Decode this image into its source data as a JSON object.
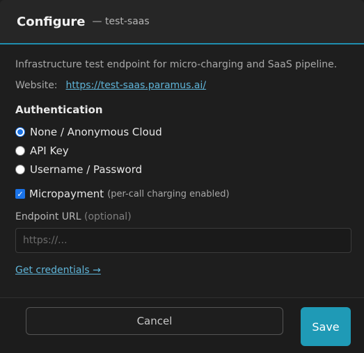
{
  "header": {
    "title": "Configure",
    "subtitle": "— test-saas"
  },
  "description": "Infrastructure test endpoint for micro-charging and SaaS pipeline.",
  "website": {
    "label": "Website:",
    "url": "https://test-saas.paramus.ai/"
  },
  "auth": {
    "title": "Authentication",
    "options": [
      {
        "label": "None / Anonymous Cloud",
        "checked": true
      },
      {
        "label": "API Key",
        "checked": false
      },
      {
        "label": "Username / Password",
        "checked": false
      }
    ]
  },
  "micropayment": {
    "label": "Micropayment",
    "hint": "(per-call charging enabled)",
    "checked": true
  },
  "endpoint": {
    "label": "Endpoint URL",
    "optional": "(optional)",
    "placeholder": "https://...",
    "value": ""
  },
  "credentials_link": "Get credentials →",
  "footer": {
    "cancel_label": "Cancel",
    "save_label": "Save"
  },
  "colors": {
    "accent": "#1f9ab6",
    "link": "#5fb4d8"
  }
}
